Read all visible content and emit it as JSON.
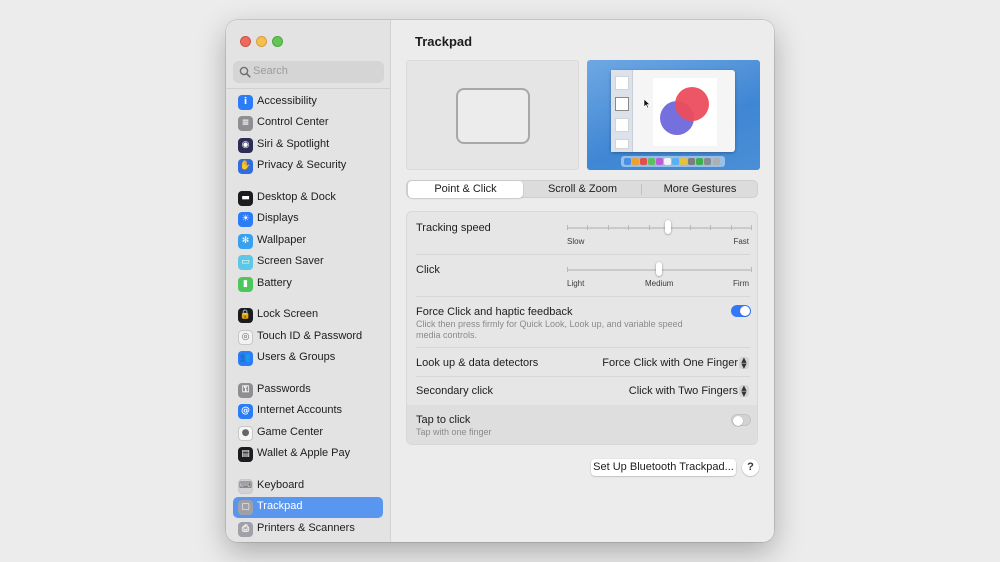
{
  "window": {
    "title": "Trackpad"
  },
  "colors": {
    "accent": "#3478f6",
    "sidebar_selected": "#5896f0",
    "close": "#ed6a5e",
    "minimize": "#f5be4f",
    "maximize": "#62c554"
  },
  "search": {
    "placeholder": "Search"
  },
  "sidebar": {
    "items": [
      {
        "label": "Accessibility",
        "icon": "accessibility-icon",
        "color": "#2b7cf6",
        "glyph": "i"
      },
      {
        "label": "Control Center",
        "icon": "control-center-icon",
        "color": "#8e8e93",
        "glyph": "≡"
      },
      {
        "label": "Siri & Spotlight",
        "icon": "siri-icon",
        "color": "#2c2c54",
        "glyph": "◉"
      },
      {
        "label": "Privacy & Security",
        "icon": "hand-icon",
        "color": "#2f6de1",
        "glyph": "✋"
      },
      {
        "label": "Desktop & Dock",
        "icon": "dock-icon",
        "color": "#1c1c1e",
        "glyph": "▬"
      },
      {
        "label": "Displays",
        "icon": "sun-icon",
        "color": "#2b7cf6",
        "glyph": "☀"
      },
      {
        "label": "Wallpaper",
        "icon": "flower-icon",
        "color": "#39a0f0",
        "glyph": "✻"
      },
      {
        "label": "Screen Saver",
        "icon": "screen-saver-icon",
        "color": "#5ac8e6",
        "glyph": "▭"
      },
      {
        "label": "Battery",
        "icon": "battery-icon",
        "color": "#4cc85a",
        "glyph": "▮"
      },
      {
        "label": "Lock Screen",
        "icon": "lock-icon",
        "color": "#1c1c1e",
        "glyph": "🔒"
      },
      {
        "label": "Touch ID & Password",
        "icon": "fingerprint-icon",
        "color": "#f2f2f2",
        "glyph": "◎"
      },
      {
        "label": "Users & Groups",
        "icon": "users-icon",
        "color": "#2b7cf6",
        "glyph": "👥"
      },
      {
        "label": "Passwords",
        "icon": "key-icon",
        "color": "#8e8e93",
        "glyph": "⚿"
      },
      {
        "label": "Internet Accounts",
        "icon": "at-icon",
        "color": "#2b7cf6",
        "glyph": "@"
      },
      {
        "label": "Game Center",
        "icon": "game-center-icon",
        "color": "#f5f5f5",
        "glyph": "●"
      },
      {
        "label": "Wallet & Apple Pay",
        "icon": "wallet-icon",
        "color": "#1c1c1e",
        "glyph": "▤"
      },
      {
        "label": "Keyboard",
        "icon": "keyboard-icon",
        "color": "#d1d1d6",
        "glyph": "⌨"
      },
      {
        "label": "Trackpad",
        "icon": "trackpad-icon",
        "color": "#a0a0a8",
        "glyph": "▢"
      },
      {
        "label": "Printers & Scanners",
        "icon": "printer-icon",
        "color": "#a0a0a8",
        "glyph": "⎙"
      }
    ]
  },
  "tabs": [
    {
      "label": "Point & Click",
      "selected": true
    },
    {
      "label": "Scroll & Zoom",
      "selected": false
    },
    {
      "label": "More Gestures",
      "selected": false
    }
  ],
  "settings": {
    "tracking_speed": {
      "label": "Tracking speed",
      "min_label": "Slow",
      "max_label": "Fast",
      "value": 0.55
    },
    "click": {
      "label": "Click",
      "min_label": "Light",
      "mid_label": "Medium",
      "max_label": "Firm",
      "value": 0.5
    },
    "force_click": {
      "label": "Force Click and haptic feedback",
      "description": "Click then press firmly for Quick Look, Look up, and variable speed media controls.",
      "enabled": true
    },
    "look_up": {
      "label": "Look up & data detectors",
      "value": "Force Click with One Finger"
    },
    "secondary_click": {
      "label": "Secondary click",
      "value": "Click with Two Fingers"
    },
    "tap_to_click": {
      "label": "Tap to click",
      "description": "Tap with one finger",
      "enabled": false
    }
  },
  "buttons": {
    "bluetooth": "Set Up Bluetooth Trackpad...",
    "help": "?"
  }
}
